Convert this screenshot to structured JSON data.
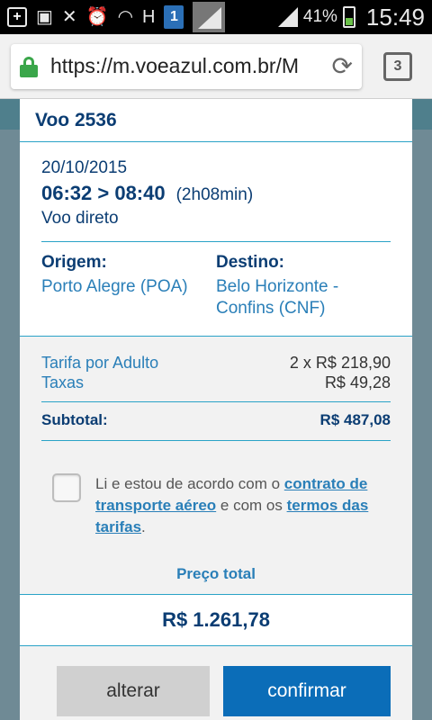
{
  "status_bar": {
    "notification_count": "1",
    "h_label": "H",
    "battery_percent": "41%",
    "time": "15:49"
  },
  "browser": {
    "url": "https://m.voeazul.com.br/M",
    "tab_count": "3"
  },
  "booking": {
    "flight_title": "Voo 2536",
    "date": "20/10/2015",
    "time_range": "06:32 > 08:40",
    "duration": "(2h08min)",
    "flight_type": "Voo direto",
    "origin_label": "Origem:",
    "origin_value": "Porto Alegre (POA)",
    "destination_label": "Destino:",
    "destination_value": "Belo Horizonte - Confins (CNF)"
  },
  "fares": {
    "adult_label": "Tarifa por Adulto",
    "adult_value": "2 x R$ 218,90",
    "taxes_label": "Taxas",
    "taxes_value": "R$ 49,28",
    "subtotal_label": "Subtotal:",
    "subtotal_value": "R$ 487,08"
  },
  "agreement": {
    "text_1": "Li e estou de acordo com o ",
    "link_1": "contrato de transporte aéreo",
    "text_2": " e com os ",
    "link_2": "termos das tarifas",
    "text_3": "."
  },
  "total": {
    "label": "Preço total",
    "value": "R$ 1.261,78"
  },
  "actions": {
    "alter_label": "alterar",
    "confirm_label": "confirmar"
  }
}
